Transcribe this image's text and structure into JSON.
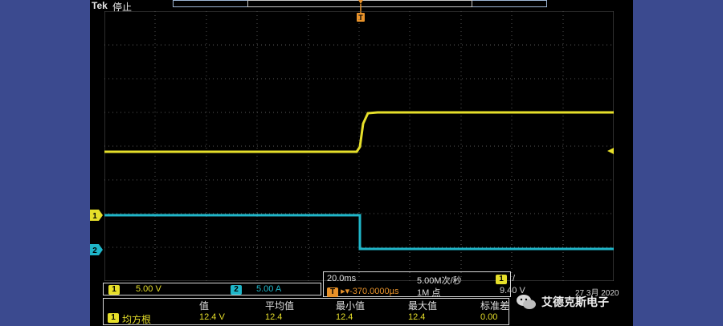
{
  "header": {
    "brand": "Tek",
    "status": "停止"
  },
  "channels": [
    {
      "id": "1",
      "color": "#e6df2a",
      "scale": "5.00 V"
    },
    {
      "id": "2",
      "color": "#1fb6c9",
      "scale": "5.00 A"
    }
  ],
  "trigger_marker": "T",
  "timebase": {
    "scale": "20.0ms",
    "sample_rate": "5.00M次/秒",
    "position": "▸▾-370.0000µs",
    "record_length": "1M 点"
  },
  "trigger": {
    "channel": "1",
    "slope": "/",
    "level": "9.40 V"
  },
  "date": "27 3月 2020",
  "measurement": {
    "channel": "1",
    "name": "均方根",
    "headers": [
      "值",
      "平均值",
      "最小值",
      "最大值",
      "标准差"
    ],
    "values": [
      "12.4 V",
      "12.4",
      "12.4",
      "12.4",
      "0.00"
    ]
  },
  "watermark": {
    "text": "艾德克斯电子"
  }
}
